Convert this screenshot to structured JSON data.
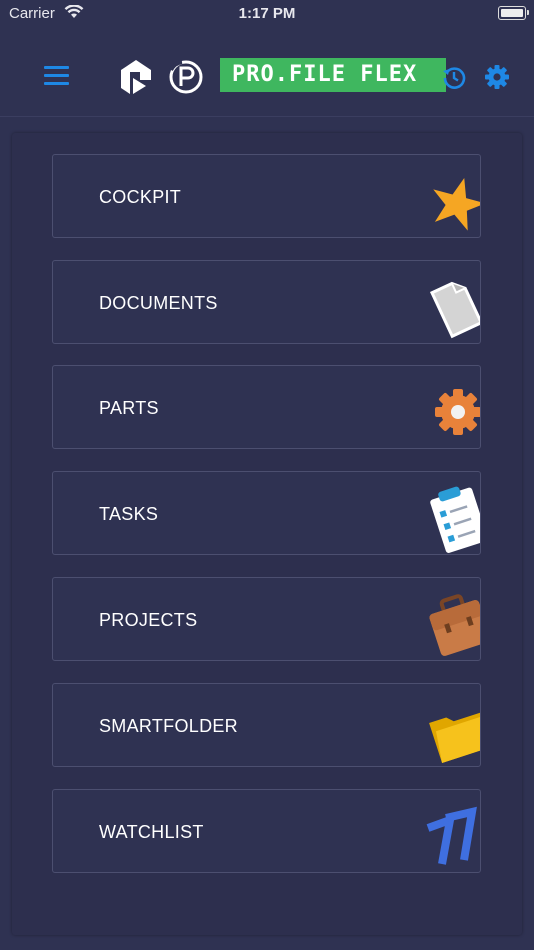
{
  "status_bar": {
    "carrier": "Carrier",
    "time": "1:17 PM"
  },
  "header": {
    "menu_icon": "hamburger-menu-icon",
    "brand": "PRO.FILE FLEX",
    "brand_color": "#3fb75f",
    "accent_color": "#1e88e5",
    "history_icon": "history-icon",
    "settings_icon": "gear-icon"
  },
  "menu": {
    "items": [
      {
        "label": "COCKPIT",
        "icon": "star-icon",
        "icon_color": "#f5a623"
      },
      {
        "label": "DOCUMENTS",
        "icon": "document-icon",
        "icon_color": "#d9d9d9"
      },
      {
        "label": "PARTS",
        "icon": "gear-icon",
        "icon_color": "#e8823a"
      },
      {
        "label": "TASKS",
        "icon": "clipboard-icon",
        "icon_color": "#2a9dd6"
      },
      {
        "label": "PROJECTS",
        "icon": "briefcase-icon",
        "icon_color": "#c97b47"
      },
      {
        "label": "SMARTFOLDER",
        "icon": "folder-icon",
        "icon_color": "#f6c21c"
      },
      {
        "label": "WATCHLIST",
        "icon": "chevrons-icon",
        "icon_color": "#3f6fe0"
      }
    ]
  }
}
